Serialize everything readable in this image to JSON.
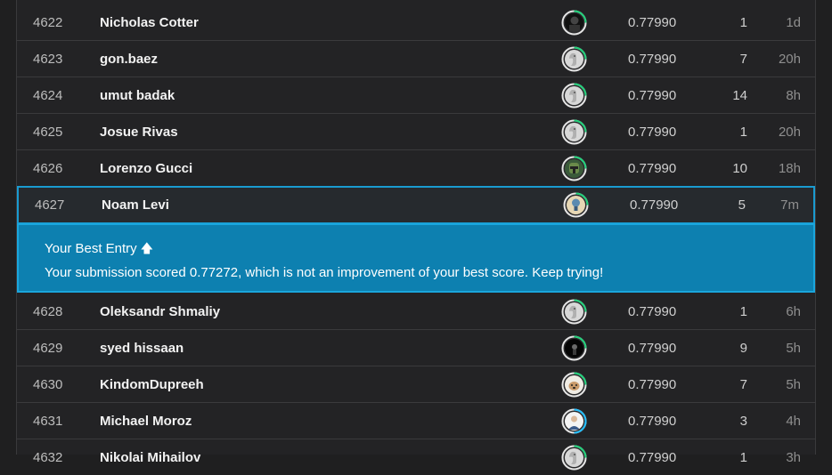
{
  "rows_top": [
    {
      "rank": "4622",
      "name": "Nicholas Cotter",
      "avatar": "dark-portrait-avatar",
      "score": "0.77990",
      "entries": "1",
      "last": "1d"
    },
    {
      "rank": "4623",
      "name": "gon.baez",
      "avatar": "default-goose-avatar",
      "score": "0.77990",
      "entries": "7",
      "last": "20h"
    },
    {
      "rank": "4624",
      "name": "umut badak",
      "avatar": "default-goose-avatar",
      "score": "0.77990",
      "entries": "14",
      "last": "8h"
    },
    {
      "rank": "4625",
      "name": "Josue Rivas",
      "avatar": "default-goose-avatar",
      "score": "0.77990",
      "entries": "1",
      "last": "20h"
    },
    {
      "rank": "4626",
      "name": "Lorenzo Gucci",
      "avatar": "boba-fett-avatar",
      "score": "0.77990",
      "entries": "10",
      "last": "18h"
    }
  ],
  "me_row": {
    "rank": "4627",
    "name": "Noam Levi",
    "avatar": "lightbulb-avatar",
    "score": "0.77990",
    "entries": "5",
    "last": "7m"
  },
  "banner": {
    "title": "Your Best Entry",
    "message": "Your submission scored 0.77272, which is not an improvement of your best score. Keep trying!"
  },
  "rows_bottom": [
    {
      "rank": "4628",
      "name": "Oleksandr Shmaliy",
      "avatar": "default-goose-avatar",
      "score": "0.77990",
      "entries": "1",
      "last": "6h"
    },
    {
      "rank": "4629",
      "name": "syed hissaan",
      "avatar": "dark-figure-avatar",
      "score": "0.77990",
      "entries": "9",
      "last": "5h"
    },
    {
      "rank": "4630",
      "name": "KindomDupreeh",
      "avatar": "dog-avatar",
      "score": "0.77990",
      "entries": "7",
      "last": "5h"
    },
    {
      "rank": "4631",
      "name": "Michael Moroz",
      "avatar": "person-photo-avatar",
      "score": "0.77990",
      "entries": "3",
      "last": "4h"
    },
    {
      "rank": "4632",
      "name": "Nikolai Mihailov",
      "avatar": "default-goose-avatar",
      "score": "0.77990",
      "entries": "1",
      "last": "3h"
    }
  ],
  "colors": {
    "accent": "#1a9bd0",
    "banner_bg": "#0d80b0",
    "ring_green": "#20beff"
  }
}
